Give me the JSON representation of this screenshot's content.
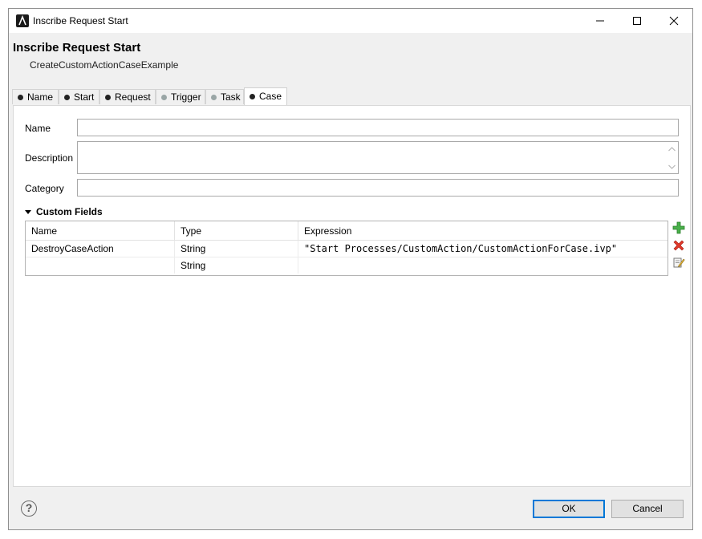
{
  "window": {
    "title": "Inscribe Request Start"
  },
  "header": {
    "title": "Inscribe Request Start",
    "subtitle": "CreateCustomActionCaseExample"
  },
  "tabs": [
    {
      "label": "Name",
      "enabled": true
    },
    {
      "label": "Start",
      "enabled": true
    },
    {
      "label": "Request",
      "enabled": true
    },
    {
      "label": "Trigger",
      "enabled": false
    },
    {
      "label": "Task",
      "enabled": false
    },
    {
      "label": "Case",
      "enabled": true,
      "active": true
    }
  ],
  "form": {
    "name_label": "Name",
    "name_value": "",
    "description_label": "Description",
    "description_value": "",
    "category_label": "Category",
    "category_value": ""
  },
  "custom_fields": {
    "section_title": "Custom Fields",
    "columns": [
      "Name",
      "Type",
      "Expression"
    ],
    "rows": [
      {
        "name": "DestroyCaseAction",
        "type": "String",
        "expression": "\"Start Processes/CustomAction/CustomActionForCase.ivp\""
      },
      {
        "name": "",
        "type": "String",
        "expression": ""
      }
    ]
  },
  "buttons": {
    "ok": "OK",
    "cancel": "Cancel",
    "help": "?"
  },
  "colors": {
    "accent": "#0078d7",
    "add_icon": "#3aa13a",
    "delete_icon": "#d9261c"
  }
}
